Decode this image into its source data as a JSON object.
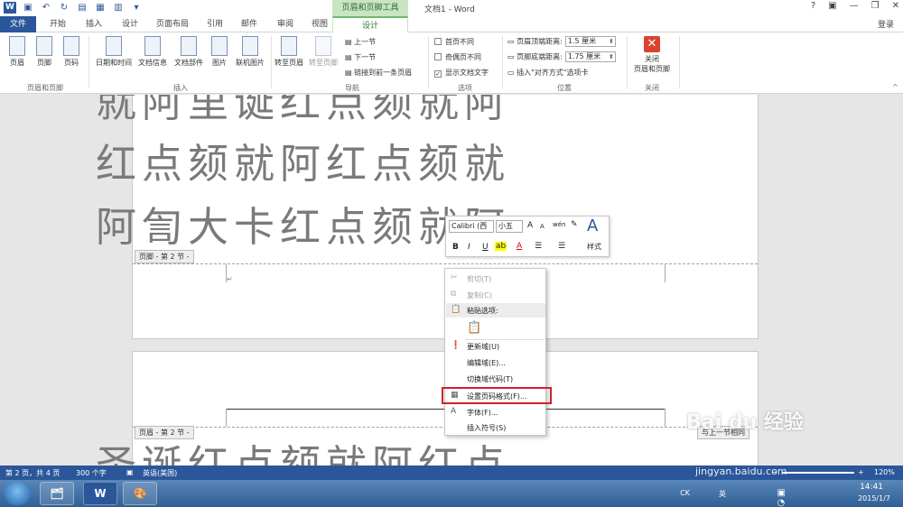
{
  "window": {
    "context_tab_group": "页眉和页脚工具",
    "doc_title": "文档1 - Word",
    "help": "?",
    "minimize": "—",
    "restore": "❐",
    "close": "✕",
    "login": "登录"
  },
  "tabs": [
    "文件",
    "开始",
    "插入",
    "设计",
    "页面布局",
    "引用",
    "邮件",
    "审阅",
    "视图",
    "设计"
  ],
  "ribbon": {
    "header_btn": "页眉",
    "footer_btn": "页脚",
    "page_num_btn": "页码",
    "group_hf": "页眉和页脚",
    "datetime_btn": "日期和时间",
    "docinfo_btn": "文档信息",
    "docparts_btn": "文档部件",
    "picture_btn": "图片",
    "online_picture_btn": "联机图片",
    "group_insert": "插入",
    "goto_header_btn": "转至页眉",
    "goto_footer_btn": "转至页脚",
    "prev_section": "上一节",
    "next_section": "下一节",
    "link_prev": "链接到前一条页眉",
    "group_nav": "导航",
    "diff_first": "首页不同",
    "diff_odd_even": "奇偶页不同",
    "show_doc_text": "显示文档文字",
    "group_options": "选项",
    "header_top_label": "页眉顶端距离:",
    "header_top_value": "1.5 厘米",
    "footer_bottom_label": "页脚底端距离:",
    "footer_bottom_value": "1.75 厘米",
    "insert_align_tab": "插入\"对齐方式\"选项卡",
    "group_position": "位置",
    "close_btn_line1": "关闭",
    "close_btn_line2": "页眉和页脚",
    "group_close": "关闭"
  },
  "document": {
    "line1": "就阿里诞红点颏就阿",
    "line2": "红点颏就阿红点颏就",
    "line3": "阿訇大卡红点颏就阿",
    "footer_tag": "页脚 - 第 2 节 -",
    "header_tag": "页眉 - 第 2 节 -",
    "link_prev_tag": "与上一节相同",
    "page2_line": "圣诞红点颏就阿红点",
    "para_mark": "↵"
  },
  "mini_toolbar": {
    "font": "Calibri (西",
    "size": "小五",
    "grow": "A",
    "shrink": "A",
    "phonetic": "wén",
    "styles_btn": "样式",
    "bold": "B",
    "italic": "I",
    "underline": "U",
    "font_color": "A"
  },
  "context_menu": {
    "cut": "剪切(T)",
    "copy": "复制(C)",
    "paste_options": "粘贴选项:",
    "update_field": "更新域(U)",
    "edit_field": "编辑域(E)...",
    "toggle_field_codes": "切换域代码(T)",
    "format_page_numbers": "设置页码格式(F)...",
    "font": "字体(F)...",
    "insert_symbol": "插入符号(S)"
  },
  "status": {
    "page": "第 2 页，共 4 页",
    "words": "300 个字",
    "lang": "英语(美国)",
    "zoom": "120%",
    "zoom_minus": "−",
    "zoom_plus": "+"
  },
  "taskbar": {
    "word_app": "W",
    "ime": "CK",
    "lang": "英",
    "time": "14:41",
    "date": "2015/1/7"
  },
  "watermark": {
    "brand": "Bai du 经验",
    "url": "jingyan.baidu.com"
  },
  "colors": {
    "accent": "#2b579a",
    "context_green": "#c9e4c3",
    "highlight_red": "#d0202c"
  }
}
